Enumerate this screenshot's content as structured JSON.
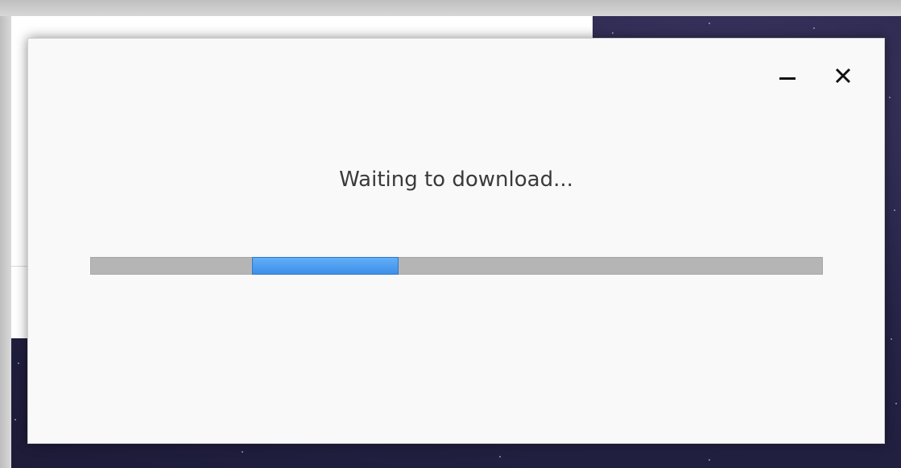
{
  "dialog": {
    "message": "Waiting to download...",
    "minimize_icon": "minimize-icon",
    "close_icon": "close-icon"
  },
  "progress": {
    "mode": "indeterminate",
    "chunk_start_fraction": 0.22,
    "chunk_end_fraction": 0.42
  },
  "colors": {
    "progress_fill": "#4a9bf0",
    "progress_track": "#b5b5b5",
    "dialog_bg": "#f9f9f9",
    "text": "#3a3a3a"
  }
}
